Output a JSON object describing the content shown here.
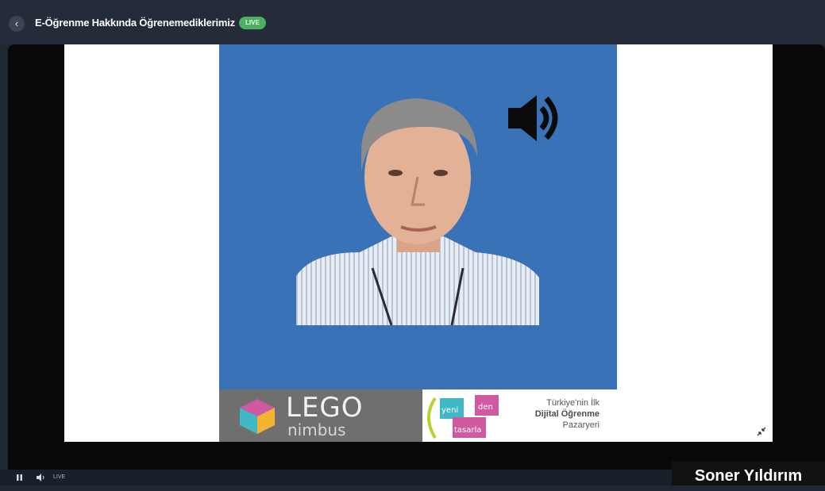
{
  "header": {
    "title": "E-Öğrenme Hakkında Öğrenemediklerimiz",
    "live_badge": "LIVE",
    "back_icon": "chevron-left-icon"
  },
  "slide": {
    "speaker_icon": "speaker-icon",
    "banner": {
      "brand_top": "LEGO",
      "brand_bottom": "nimbus",
      "art_words": [
        "yeni",
        "den",
        "tasarla"
      ],
      "tagline_line1": "Türkiye'nin İlk",
      "tagline_line2": "Dijital Öğrenme",
      "tagline_line3": "Pazaryeri"
    },
    "minimize_icon": "minimize-icon"
  },
  "controls": {
    "pause_icon": "pause-icon",
    "volume_icon": "volume-icon",
    "live_label": "LIVE"
  },
  "caption": "Soner Yıldırım",
  "colors": {
    "background": "#1f2732",
    "video_background": "#3a72b8",
    "live_badge": "#4caf62",
    "banner_gray": "#6e6f6e"
  }
}
